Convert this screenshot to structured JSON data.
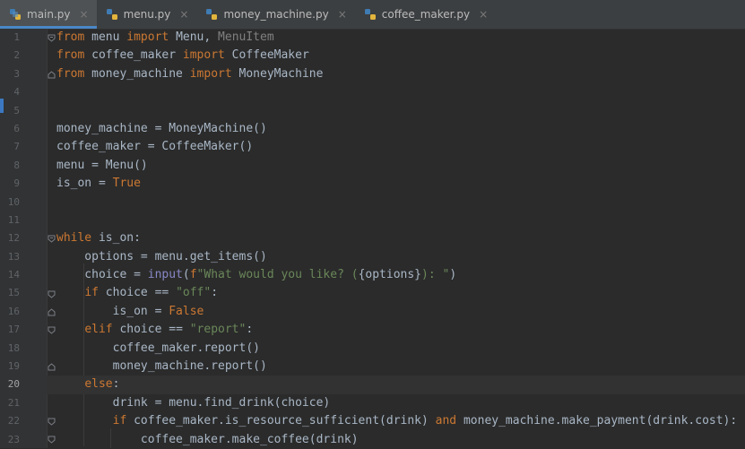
{
  "tabs": [
    {
      "label": "main.py",
      "active": true,
      "close": "×"
    },
    {
      "label": "menu.py",
      "active": false,
      "close": "×"
    },
    {
      "label": "money_machine.py",
      "active": false,
      "close": "×"
    },
    {
      "label": "coffee_maker.py",
      "active": false,
      "close": "×"
    }
  ],
  "line_numbers": [
    "1",
    "2",
    "3",
    "4",
    "5",
    "6",
    "7",
    "8",
    "9",
    "10",
    "11",
    "12",
    "13",
    "14",
    "15",
    "16",
    "17",
    "18",
    "19",
    "20",
    "21",
    "22",
    "23"
  ],
  "current_line": 20,
  "code": {
    "l1": {
      "kw1": "from",
      "t1": " menu ",
      "kw2": "import",
      "t2": " Menu, ",
      "g1": "MenuItem"
    },
    "l2": {
      "kw1": "from",
      "t1": " coffee_maker ",
      "kw2": "import",
      "t2": " CoffeeMaker"
    },
    "l3": {
      "kw1": "from",
      "t1": " money_machine ",
      "kw2": "import",
      "t2": " MoneyMachine"
    },
    "l6": {
      "t1": "money_machine = MoneyMachine()"
    },
    "l7": {
      "t1": "coffee_maker = CoffeeMaker()"
    },
    "l8": {
      "t1": "menu = Menu()"
    },
    "l9": {
      "t1": "is_on = ",
      "kw1": "True"
    },
    "l12": {
      "kw1": "while",
      "t1": " is_on:"
    },
    "l13": {
      "t1": "    options = menu.get_items()"
    },
    "l14": {
      "t1": "    choice = ",
      "bi1": "input",
      "t2": "(",
      "kw1": "f",
      "s1": "\"What would you like? (",
      "t3": "{options}",
      "s2": "): \"",
      "t4": ")"
    },
    "l15": {
      "t1": "    ",
      "kw1": "if",
      "t2": " choice == ",
      "s1": "\"off\"",
      "t3": ":"
    },
    "l16": {
      "t1": "        is_on = ",
      "kw1": "False"
    },
    "l17": {
      "t1": "    ",
      "kw1": "elif",
      "t2": " choice == ",
      "s1": "\"report\"",
      "t3": ":"
    },
    "l18": {
      "t1": "        coffee_maker.report()"
    },
    "l19": {
      "t1": "        money_machine.report()"
    },
    "l20": {
      "t1": "    ",
      "kw1": "else",
      "t2": ":"
    },
    "l21": {
      "t1": "        drink = menu.find_drink(choice)"
    },
    "l22": {
      "t1": "        ",
      "kw1": "if",
      "t2": " coffee_maker.is_resource_sufficient(drink) ",
      "kw2": "and",
      "t3": " money_machine.make_payment(drink.cost):"
    },
    "l23": {
      "t1": "            coffee_maker.make_coffee(drink)"
    }
  }
}
